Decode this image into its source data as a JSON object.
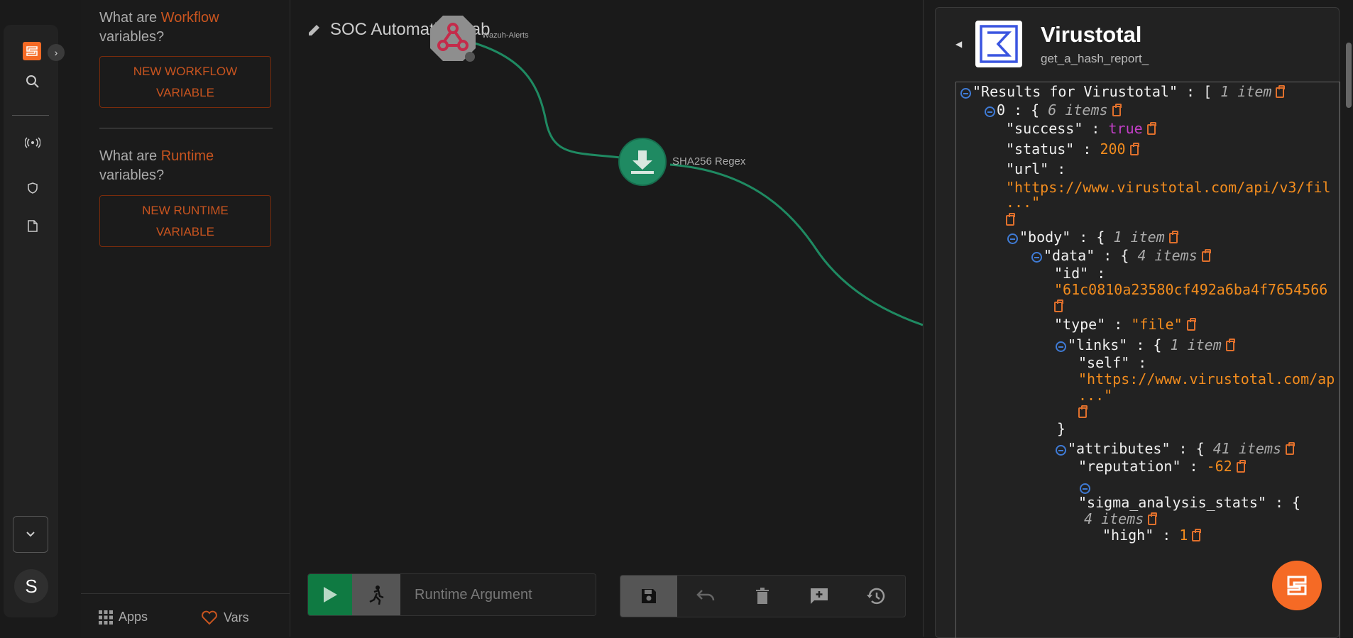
{
  "rail": {
    "icons": [
      "logo-icon",
      "search-icon",
      "broadcast-icon",
      "shield-icon",
      "document-icon",
      "chevron-down-icon"
    ],
    "avatar_letter": "S"
  },
  "vars": {
    "q1_prefix": "What are ",
    "q1_accent": "Workflow",
    "q1_suffix": "variables?",
    "workflow_btn_line1": "NEW WORKFLOW",
    "workflow_btn_line2": "VARIABLE",
    "q2_prefix": "What are ",
    "q2_accent": "Runtime",
    "q2_suffix": "variables?",
    "runtime_btn_line1": "NEW RUNTIME",
    "runtime_btn_line2": "VARIABLE",
    "apps_label": "Apps",
    "vars_label": "Vars"
  },
  "canvas": {
    "title": "SOC Automation Lab",
    "webhook_label": "Wazuh-Alerts",
    "regex_label": "SHA256 Regex",
    "runtime_placeholder": "Runtime Argument",
    "edge_color": "#1f8a62",
    "node_color": "#1f8a62"
  },
  "panel": {
    "app_name": "Virustotal",
    "action": "get_a_hash_report_",
    "accent": "#f56a25",
    "json": {
      "root_key": "\"Results for Virustotal\"",
      "root_count": "1 item",
      "idx0": "0",
      "idx0_count": "6 items",
      "success_key": "\"success\"",
      "success_val": "true",
      "status_key": "\"status\"",
      "status_val": "200",
      "url_key": "\"url\"",
      "url_val": "\"https://www.virustotal.com/api/v3/fil",
      "url_more": "...\"",
      "body_key": "\"body\"",
      "body_count": "1 item",
      "data_key": "\"data\"",
      "data_count": "4 items",
      "id_key": "\"id\"",
      "id_val": "\"61c0810a23580cf492a6ba4f7654566",
      "type_key": "\"type\"",
      "type_val": "\"file\"",
      "links_key": "\"links\"",
      "links_count": "1 item",
      "self_key": "\"self\"",
      "self_val": "\"https://www.virustotal.com/ap",
      "self_more": "...\"",
      "close_brace": "}",
      "attr_key": "\"attributes\"",
      "attr_count": "41 items",
      "rep_key": "\"reputation\"",
      "rep_val": "-62",
      "sigma_key": "\"sigma_analysis_stats\"",
      "sigma_count": "4 items",
      "high_key": "\"high\"",
      "high_val": "1"
    }
  }
}
